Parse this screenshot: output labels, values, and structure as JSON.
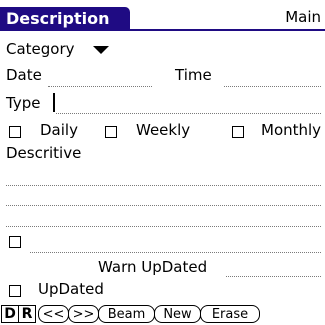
{
  "header": {
    "title": "Description",
    "category_menu": "Main"
  },
  "form": {
    "category_label": "Category",
    "date_label": "Date",
    "time_label": "Time",
    "type_label": "Type",
    "recurrence": {
      "daily": "Daily",
      "weekly": "Weekly",
      "monthly": "Monthly"
    },
    "descritive_label": "Descritive",
    "warn_updated_label": "Warn UpDated",
    "updated_label": "UpDated"
  },
  "toolbar": {
    "d_label": "D",
    "r_label": "R",
    "prev_label": "<<",
    "next_label": ">>",
    "beam_label": "Beam",
    "new_label": "New",
    "erase_label": "Erase"
  }
}
